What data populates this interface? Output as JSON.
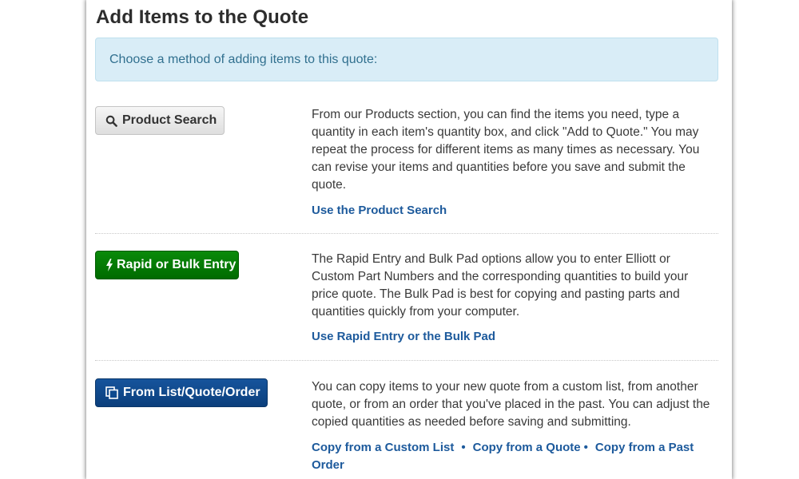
{
  "page": {
    "title": "Add Items to the Quote",
    "instruction": "Choose a method of adding items to this quote:"
  },
  "methods": [
    {
      "button_label": "Product Search",
      "icon": "search-icon",
      "color": "#e0e0e0",
      "description": "From our Products section, you can find the items you need, type a quantity in each item's quantity box, and click \"Add to Quote.\" You may repeat the process for different items as many times as necessary. You can revise your items and quantities before you save and submit the quote.",
      "links": [
        "Use the Product Search"
      ]
    },
    {
      "button_label": "Rapid or Bulk Entry",
      "icon": "lightning-bolt-icon",
      "color": "#007a00",
      "description": "The Rapid Entry and Bulk Pad options allow you to enter Elliott or Custom Part Numbers and the corresponding quantities to build your price quote. The Bulk Pad is best for copying and pasting parts and quantities quickly from your computer.",
      "links": [
        "Use Rapid Entry or the Bulk Pad"
      ]
    },
    {
      "button_label": "From List/Quote/Order",
      "icon": "copy-icon",
      "color": "#0d4a8f",
      "description": "You can copy items to your new quote from a custom list, from another quote, or from an order that you've placed in the past. You can adjust the copied quantities as needed before saving and submitting.",
      "links": [
        "Copy from a Custom List",
        "Copy from a Quote",
        "Copy from a Past Order"
      ],
      "link_separator": "•"
    }
  ]
}
